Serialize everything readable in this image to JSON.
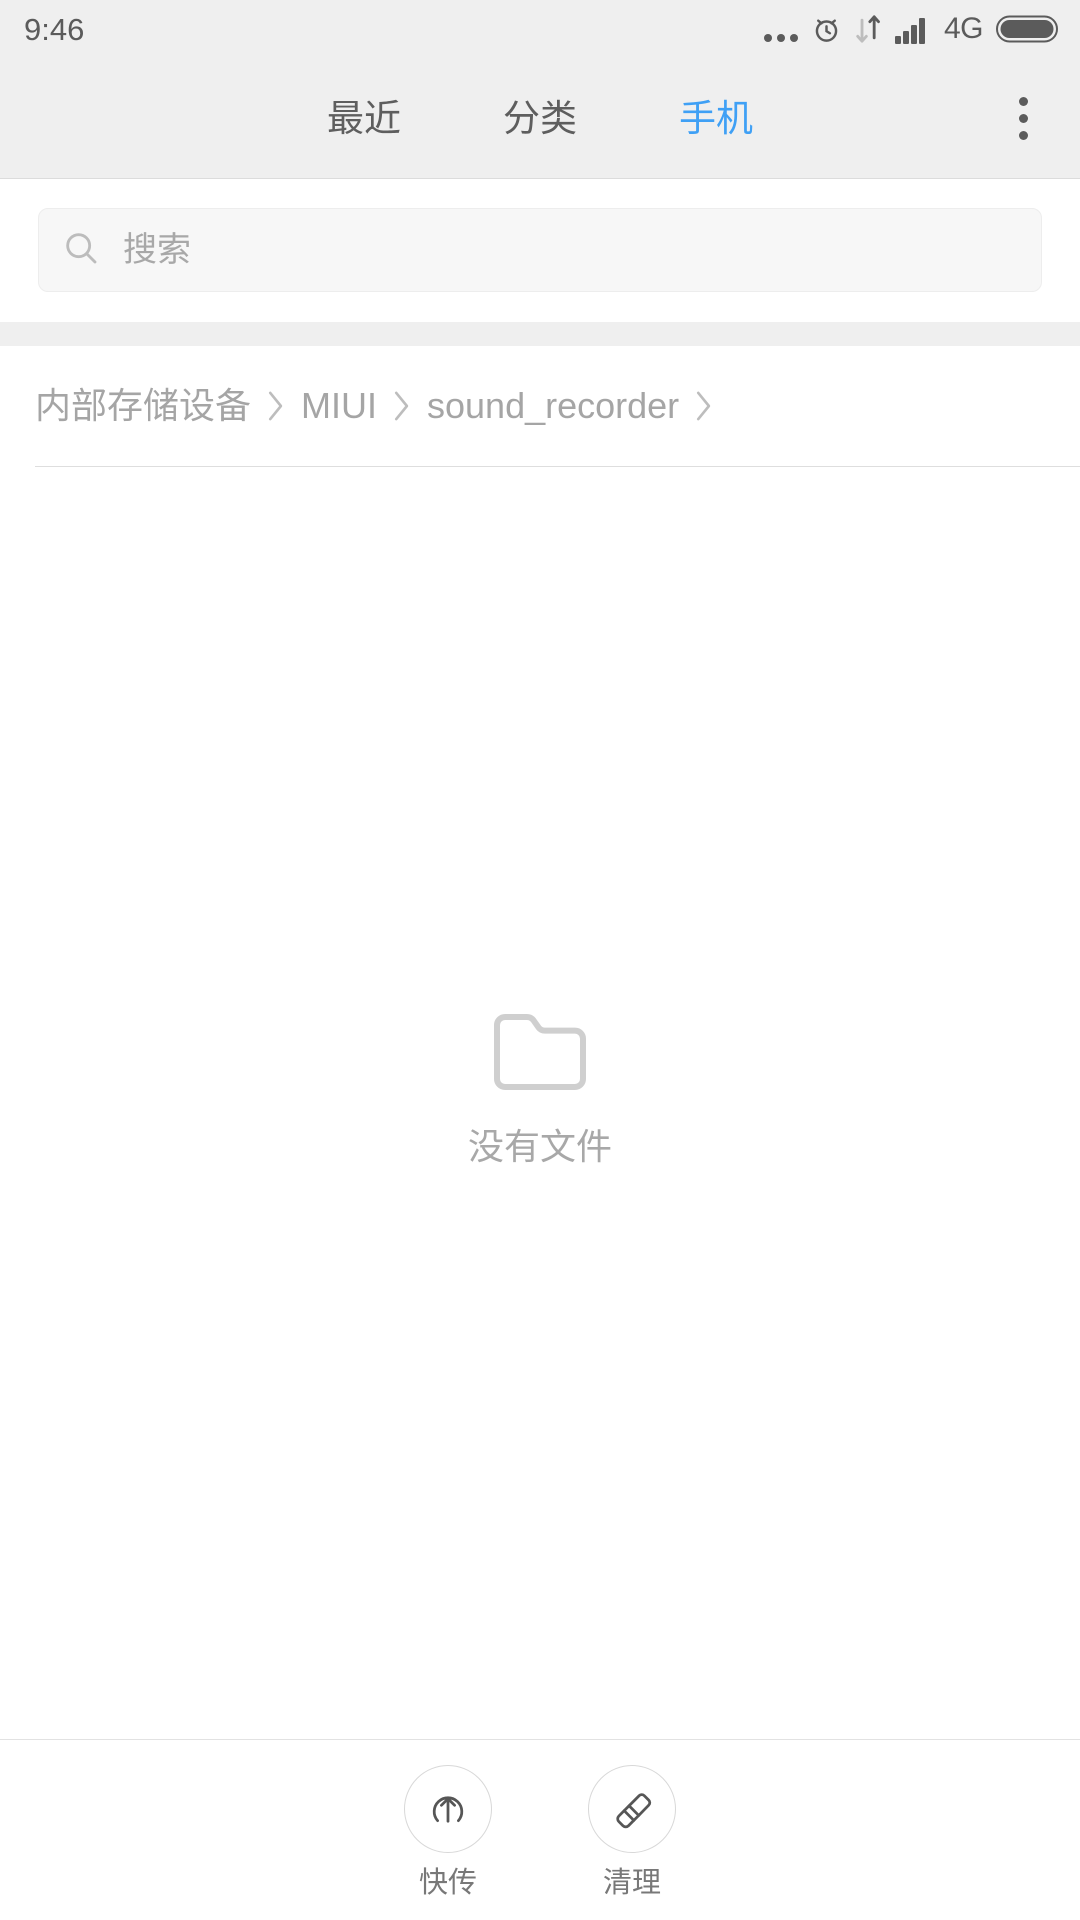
{
  "statusbar": {
    "time": "9:46",
    "icons": [
      {
        "name": "notification-dots-icon"
      },
      {
        "name": "alarm-clock-icon"
      },
      {
        "name": "data-transfer-icon"
      },
      {
        "name": "signal-bars-icon"
      },
      {
        "name": "network-type-label",
        "label": "4G"
      },
      {
        "name": "battery-icon"
      }
    ],
    "network_type": "4G"
  },
  "header": {
    "tabs": [
      {
        "label": "最近",
        "active": false
      },
      {
        "label": "分类",
        "active": false
      },
      {
        "label": "手机",
        "active": true
      }
    ],
    "overflow_menu": "more-options",
    "active_color": "#3fa0f5",
    "inactive_color": "#5e5e5e",
    "background": "#efefef"
  },
  "search": {
    "placeholder": "搜索",
    "icon": "search-icon",
    "value": ""
  },
  "breadcrumb": {
    "separator": "chevron-right-icon",
    "items": [
      {
        "label": "内部存储设备"
      },
      {
        "label": "MIUI"
      },
      {
        "label": "sound_recorder"
      }
    ],
    "trailing_separator": true
  },
  "empty_state": {
    "icon": "empty-folder-icon",
    "message": "没有文件"
  },
  "bottom_bar": {
    "actions": [
      {
        "icon": "upload-circle-arrow-icon",
        "label": "快传"
      },
      {
        "icon": "broom-clean-icon",
        "label": "清理"
      }
    ]
  }
}
